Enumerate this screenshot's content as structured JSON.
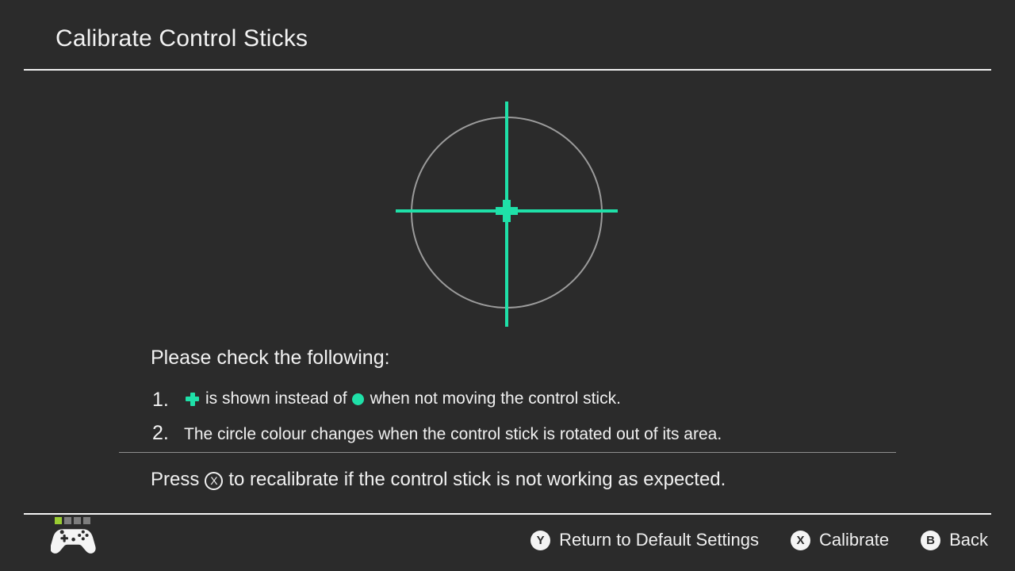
{
  "screen": {
    "title": "Calibrate Control Sticks",
    "background_color": "#2b2b2b",
    "accent_color": "#1fe0a8",
    "text_color": "#f0f0f0"
  },
  "stick_display": {
    "circle_color": "#9b9b9b",
    "crosshair_color": "#1fe0a8",
    "cursor_shape": "plus",
    "cursor_position_x": 0,
    "cursor_position_y": 0
  },
  "instructions": {
    "heading": "Please check the following:",
    "items": [
      {
        "number": "1.",
        "text_before_plus": "",
        "text_middle": "is shown instead of",
        "text_after_dot": "when not moving the control stick."
      },
      {
        "number": "2.",
        "text": "The circle colour changes when the control stick is rotated out of its area."
      }
    ],
    "press_prefix": "Press",
    "press_button": "X",
    "press_suffix": "to recalibrate if the control stick is not working as expected."
  },
  "footer": {
    "controller": {
      "icon": "gamepad-icon",
      "player_leds": [
        true,
        false,
        false,
        false
      ],
      "active_led_color": "#9acd32",
      "inactive_led_color": "#7d7d7d"
    },
    "hints": [
      {
        "button": "Y",
        "label": "Return to Default Settings"
      },
      {
        "button": "X",
        "label": "Calibrate"
      },
      {
        "button": "B",
        "label": "Back"
      }
    ]
  }
}
